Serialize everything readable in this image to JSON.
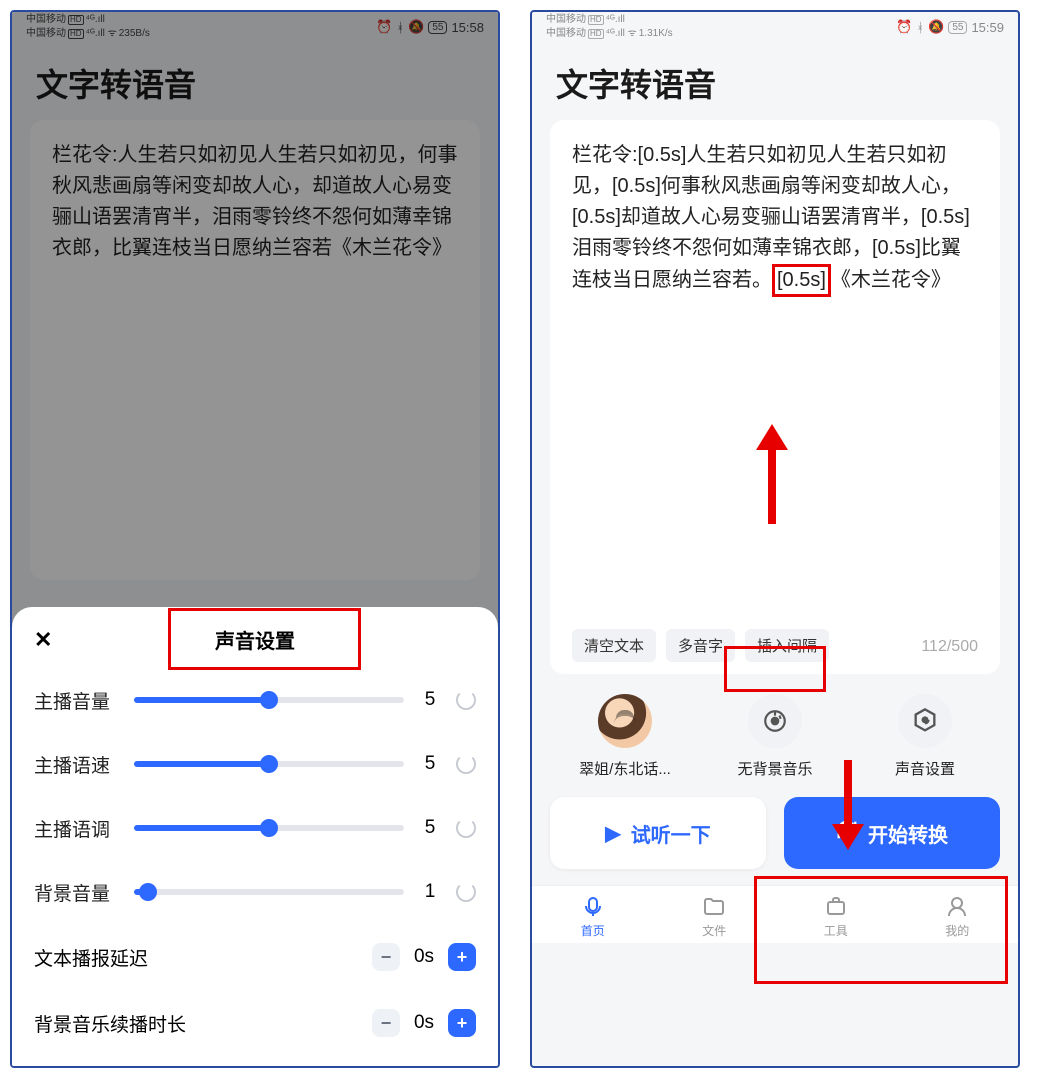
{
  "left": {
    "status": {
      "carrier": "中国移动",
      "badge": "HD",
      "net_speed": "235B/s",
      "battery": "55",
      "time": "15:58"
    },
    "page_title": "文字转语音",
    "text_content": "栏花令:人生若只如初见人生若只如初见，何事秋风悲画扇等闲变却故人心，却道故人心易变骊山语罢清宵半，泪雨零铃终不怨何如薄幸锦衣郎，比翼连枝当日愿纳兰容若《木兰花令》",
    "sheet": {
      "title": "声音设置",
      "sliders": [
        {
          "label": "主播音量",
          "value": "5",
          "pct": 50
        },
        {
          "label": "主播语速",
          "value": "5",
          "pct": 50
        },
        {
          "label": "主播语调",
          "value": "5",
          "pct": 50
        },
        {
          "label": "背景音量",
          "value": "1",
          "pct": 5
        }
      ],
      "steppers": [
        {
          "label": "文本播报延迟",
          "value": "0s"
        },
        {
          "label": "背景音乐续播时长",
          "value": "0s"
        }
      ]
    }
  },
  "right": {
    "status": {
      "carrier": "中国移动",
      "badge": "HD",
      "net_speed": "1.31K/s",
      "battery": "55",
      "time": "15:59"
    },
    "page_title": "文字转语音",
    "text_prefix": "栏花令:[0.5s]人生若只如初见人生若只如初见，[0.5s]何事秋风悲画扇等闲变却故人心，[0.5s]却道故人心易变骊山语罢清宵半，[0.5s]泪雨零铃终不怨何如薄幸锦衣郎，[0.5s]比翼连枝当日愿纳兰容若。",
    "highlight_token": "[0.5s]",
    "text_suffix": "《木兰花令》",
    "char_count": "112/500",
    "pills": [
      "清空文本",
      "多音字",
      "插入间隔"
    ],
    "options": [
      {
        "label": "翠姐/东北话..."
      },
      {
        "label": "无背景音乐"
      },
      {
        "label": "声音设置"
      }
    ],
    "buttons": {
      "preview": "试听一下",
      "convert": "开始转换"
    },
    "nav": [
      {
        "label": "首页"
      },
      {
        "label": "文件"
      },
      {
        "label": "工具"
      },
      {
        "label": "我的"
      }
    ]
  }
}
